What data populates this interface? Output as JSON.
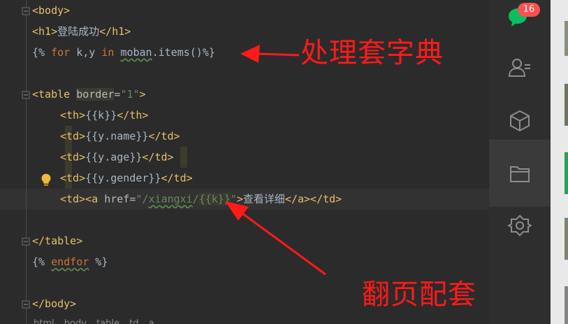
{
  "editor": {
    "lines": {
      "body_open": "<body>",
      "h1_open": "<h1>",
      "h1_text": "登陆成功",
      "h1_close": "</h1>",
      "for_open": "{% ",
      "for_kw": "for",
      "for_mid": " k,y ",
      "in_kw": "in",
      "for_sp": " ",
      "for_moban": "moban",
      "for_rest": ".items()%}",
      "table_tag_open": "<table",
      "table_attr": "border",
      "table_eq": "=",
      "table_val": "\"1\"",
      "table_gt": ">",
      "th_open": "<th>",
      "th_expr": "{{k}}",
      "th_close": "</th>",
      "td1_open": "<td>",
      "td1_expr": "{{y.name}}",
      "td1_close": "</td>",
      "td2_open": "<td>",
      "td2_expr": "{{y.age}}",
      "td2_close": "</td>",
      "td3_open": "<td>",
      "td3_expr": "{{y.gender}}",
      "td3_close": "</td>",
      "td4_open": "<td><a",
      "td4_attr": " href",
      "td4_eq": "=",
      "td4_q1": "\"/",
      "td4_path": "xiangxi",
      "td4_slash": "/",
      "td4_expr": "{{k}}",
      "td4_q2": "\"",
      "td4_gt": ">",
      "td4_text": "查看详细",
      "td4_close": "</a></td>",
      "table_close": "</table>",
      "endfor_open": "{% ",
      "endfor_kw": "endfor",
      "endfor_close": " %}",
      "body_close": "</body>"
    },
    "breadcrumb": [
      "html",
      "body",
      "table",
      "td",
      "a"
    ]
  },
  "annotations": {
    "top": "处理套字典",
    "bottom": "翻页配套",
    "color": "#ff1a1a"
  },
  "sidebar": {
    "badge_count": "16",
    "icons": [
      "wechat-chat-icon",
      "contacts-icon",
      "cube-icon",
      "folder-icon",
      "settings-hexagon-icon"
    ]
  }
}
